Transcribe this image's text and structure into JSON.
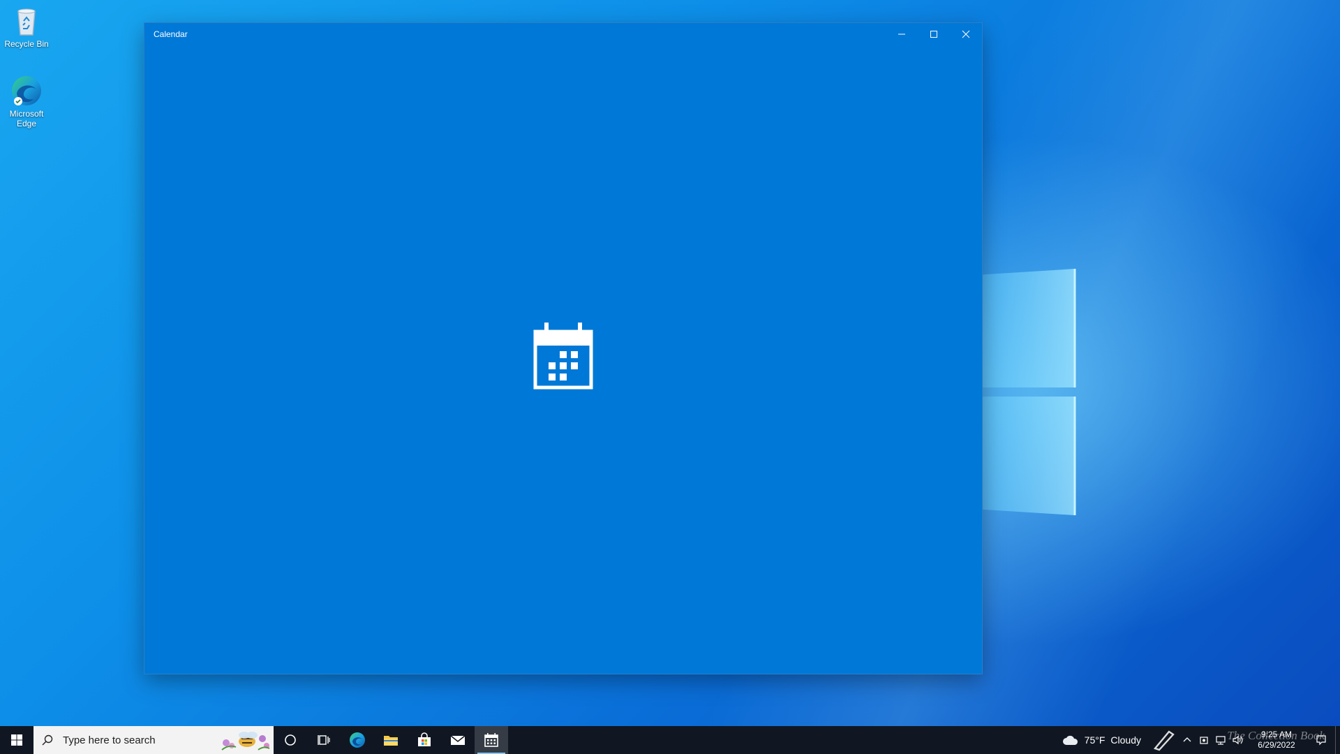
{
  "desktop": {
    "icons": [
      {
        "label": "Recycle Bin",
        "icon": "recycle-bin-icon"
      },
      {
        "label": "Microsoft Edge",
        "icon": "edge-icon"
      }
    ]
  },
  "window": {
    "title": "Calendar",
    "background": "#0078d7",
    "splash_icon": "calendar-icon",
    "controls": {
      "minimize": "minimize-icon",
      "maximize": "maximize-icon",
      "close": "close-icon"
    }
  },
  "taskbar": {
    "search_placeholder": "Type here to search",
    "pinned": [
      {
        "name": "cortana",
        "icon": "cortana-circle-icon"
      },
      {
        "name": "task-view",
        "icon": "task-view-icon"
      },
      {
        "name": "edge",
        "icon": "edge-icon"
      },
      {
        "name": "file-explorer",
        "icon": "folder-icon"
      },
      {
        "name": "microsoft-store",
        "icon": "store-bag-icon"
      },
      {
        "name": "mail",
        "icon": "mail-icon"
      },
      {
        "name": "calendar",
        "icon": "calendar-icon",
        "active": true
      }
    ],
    "weather": {
      "temp": "75°F",
      "condition": "Cloudy"
    },
    "clock": {
      "time": "9:25 AM",
      "date": "6/29/2022"
    },
    "watermark": "The Collection Book"
  }
}
